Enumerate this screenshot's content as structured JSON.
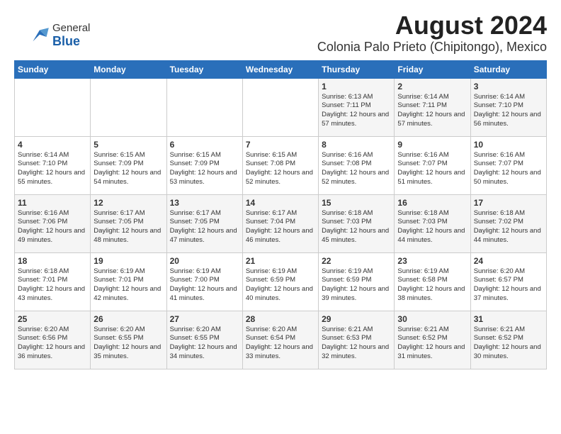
{
  "logo": {
    "general": "General",
    "blue": "Blue"
  },
  "header": {
    "month_year": "August 2024",
    "location": "Colonia Palo Prieto (Chipitongo), Mexico"
  },
  "weekdays": [
    "Sunday",
    "Monday",
    "Tuesday",
    "Wednesday",
    "Thursday",
    "Friday",
    "Saturday"
  ],
  "weeks": [
    [
      {
        "day": "",
        "text": ""
      },
      {
        "day": "",
        "text": ""
      },
      {
        "day": "",
        "text": ""
      },
      {
        "day": "",
        "text": ""
      },
      {
        "day": "1",
        "text": "Sunrise: 6:13 AM\nSunset: 7:11 PM\nDaylight: 12 hours\nand 57 minutes."
      },
      {
        "day": "2",
        "text": "Sunrise: 6:14 AM\nSunset: 7:11 PM\nDaylight: 12 hours\nand 57 minutes."
      },
      {
        "day": "3",
        "text": "Sunrise: 6:14 AM\nSunset: 7:10 PM\nDaylight: 12 hours\nand 56 minutes."
      }
    ],
    [
      {
        "day": "4",
        "text": "Sunrise: 6:14 AM\nSunset: 7:10 PM\nDaylight: 12 hours\nand 55 minutes."
      },
      {
        "day": "5",
        "text": "Sunrise: 6:15 AM\nSunset: 7:09 PM\nDaylight: 12 hours\nand 54 minutes."
      },
      {
        "day": "6",
        "text": "Sunrise: 6:15 AM\nSunset: 7:09 PM\nDaylight: 12 hours\nand 53 minutes."
      },
      {
        "day": "7",
        "text": "Sunrise: 6:15 AM\nSunset: 7:08 PM\nDaylight: 12 hours\nand 52 minutes."
      },
      {
        "day": "8",
        "text": "Sunrise: 6:16 AM\nSunset: 7:08 PM\nDaylight: 12 hours\nand 52 minutes."
      },
      {
        "day": "9",
        "text": "Sunrise: 6:16 AM\nSunset: 7:07 PM\nDaylight: 12 hours\nand 51 minutes."
      },
      {
        "day": "10",
        "text": "Sunrise: 6:16 AM\nSunset: 7:07 PM\nDaylight: 12 hours\nand 50 minutes."
      }
    ],
    [
      {
        "day": "11",
        "text": "Sunrise: 6:16 AM\nSunset: 7:06 PM\nDaylight: 12 hours\nand 49 minutes."
      },
      {
        "day": "12",
        "text": "Sunrise: 6:17 AM\nSunset: 7:05 PM\nDaylight: 12 hours\nand 48 minutes."
      },
      {
        "day": "13",
        "text": "Sunrise: 6:17 AM\nSunset: 7:05 PM\nDaylight: 12 hours\nand 47 minutes."
      },
      {
        "day": "14",
        "text": "Sunrise: 6:17 AM\nSunset: 7:04 PM\nDaylight: 12 hours\nand 46 minutes."
      },
      {
        "day": "15",
        "text": "Sunrise: 6:18 AM\nSunset: 7:03 PM\nDaylight: 12 hours\nand 45 minutes."
      },
      {
        "day": "16",
        "text": "Sunrise: 6:18 AM\nSunset: 7:03 PM\nDaylight: 12 hours\nand 44 minutes."
      },
      {
        "day": "17",
        "text": "Sunrise: 6:18 AM\nSunset: 7:02 PM\nDaylight: 12 hours\nand 44 minutes."
      }
    ],
    [
      {
        "day": "18",
        "text": "Sunrise: 6:18 AM\nSunset: 7:01 PM\nDaylight: 12 hours\nand 43 minutes."
      },
      {
        "day": "19",
        "text": "Sunrise: 6:19 AM\nSunset: 7:01 PM\nDaylight: 12 hours\nand 42 minutes."
      },
      {
        "day": "20",
        "text": "Sunrise: 6:19 AM\nSunset: 7:00 PM\nDaylight: 12 hours\nand 41 minutes."
      },
      {
        "day": "21",
        "text": "Sunrise: 6:19 AM\nSunset: 6:59 PM\nDaylight: 12 hours\nand 40 minutes."
      },
      {
        "day": "22",
        "text": "Sunrise: 6:19 AM\nSunset: 6:59 PM\nDaylight: 12 hours\nand 39 minutes."
      },
      {
        "day": "23",
        "text": "Sunrise: 6:19 AM\nSunset: 6:58 PM\nDaylight: 12 hours\nand 38 minutes."
      },
      {
        "day": "24",
        "text": "Sunrise: 6:20 AM\nSunset: 6:57 PM\nDaylight: 12 hours\nand 37 minutes."
      }
    ],
    [
      {
        "day": "25",
        "text": "Sunrise: 6:20 AM\nSunset: 6:56 PM\nDaylight: 12 hours\nand 36 minutes."
      },
      {
        "day": "26",
        "text": "Sunrise: 6:20 AM\nSunset: 6:55 PM\nDaylight: 12 hours\nand 35 minutes."
      },
      {
        "day": "27",
        "text": "Sunrise: 6:20 AM\nSunset: 6:55 PM\nDaylight: 12 hours\nand 34 minutes."
      },
      {
        "day": "28",
        "text": "Sunrise: 6:20 AM\nSunset: 6:54 PM\nDaylight: 12 hours\nand 33 minutes."
      },
      {
        "day": "29",
        "text": "Sunrise: 6:21 AM\nSunset: 6:53 PM\nDaylight: 12 hours\nand 32 minutes."
      },
      {
        "day": "30",
        "text": "Sunrise: 6:21 AM\nSunset: 6:52 PM\nDaylight: 12 hours\nand 31 minutes."
      },
      {
        "day": "31",
        "text": "Sunrise: 6:21 AM\nSunset: 6:52 PM\nDaylight: 12 hours\nand 30 minutes."
      }
    ]
  ]
}
